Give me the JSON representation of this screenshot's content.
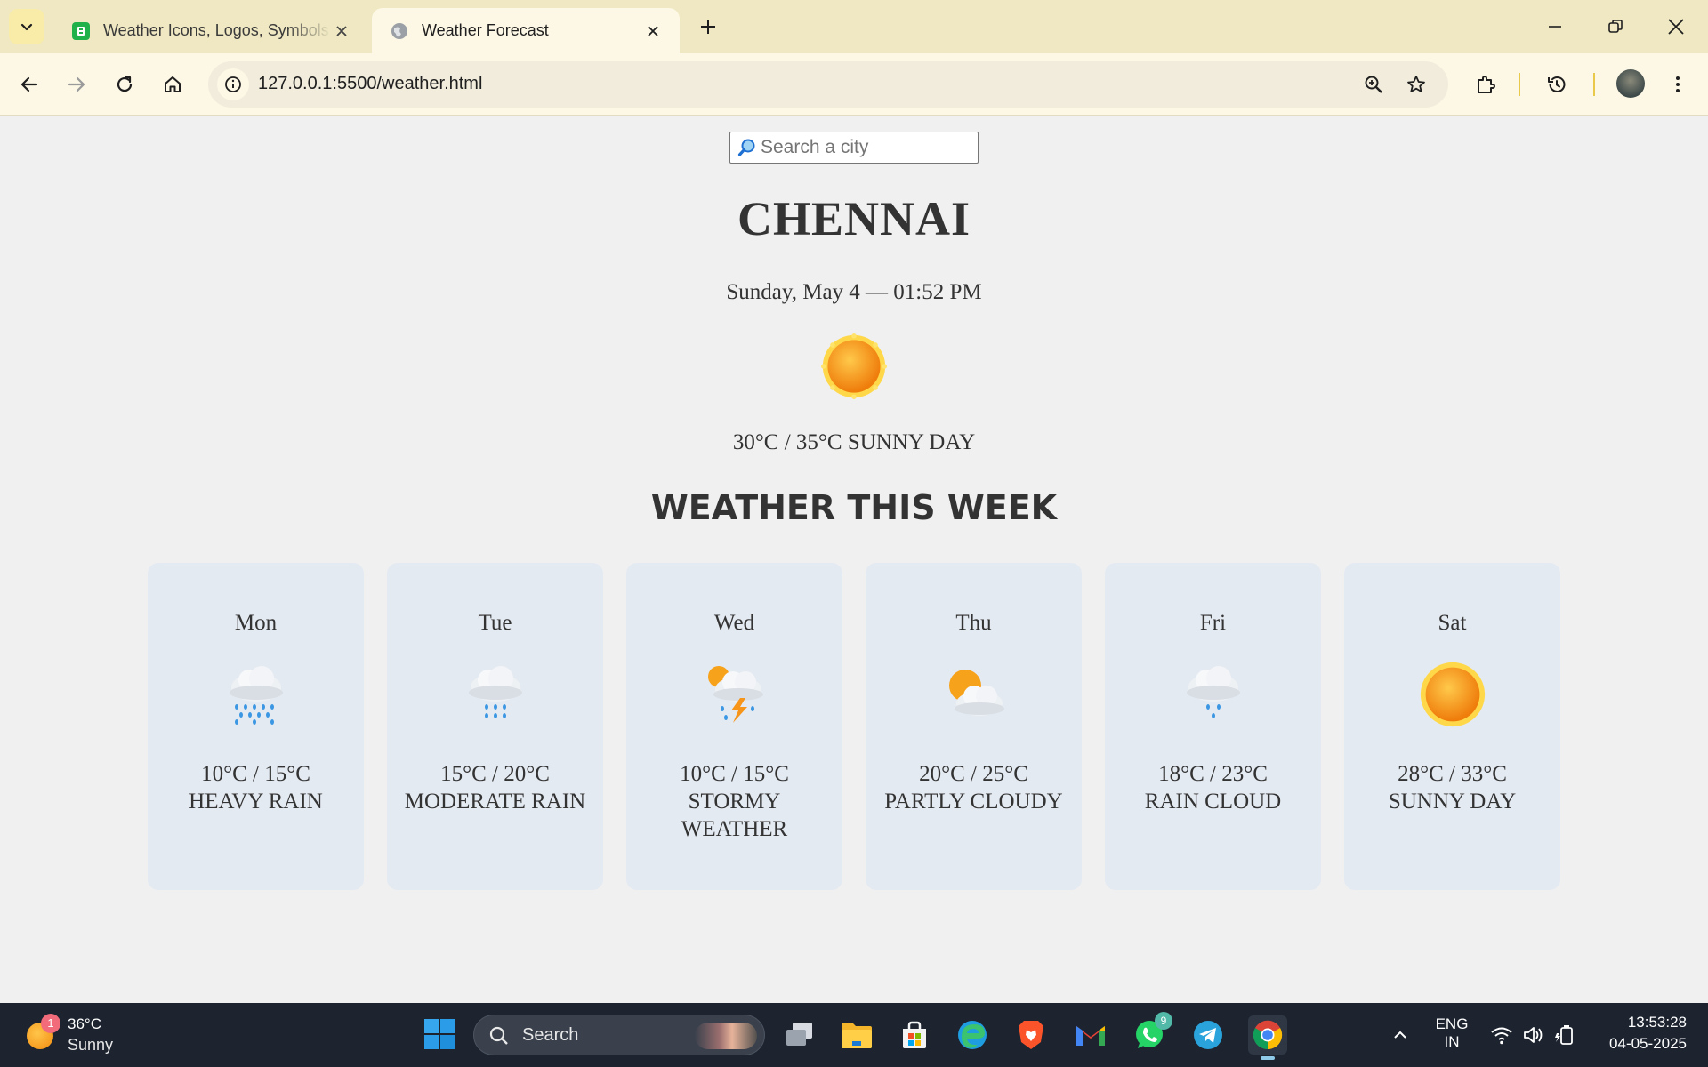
{
  "browser": {
    "tabs": [
      {
        "title": "Weather Icons, Logos, Symbols",
        "active": false
      },
      {
        "title": "Weather Forecast",
        "active": true
      }
    ],
    "url": "127.0.0.1:5500/weather.html",
    "accent": "#efe8c2"
  },
  "search": {
    "placeholder": "Search a city"
  },
  "current": {
    "city": "CHENNAI",
    "datetime": "Sunday, May 4 — 01:52 PM",
    "icon": "sun-icon",
    "summary": "30°C / 35°C SUNNY DAY"
  },
  "week": {
    "heading": "WEATHER THIS WEEK",
    "days": [
      {
        "day": "Mon",
        "temp": "10°C / 15°C",
        "desc": "HEAVY RAIN",
        "icon": "heavy-rain-icon"
      },
      {
        "day": "Tue",
        "temp": "15°C / 20°C",
        "desc": "MODERATE RAIN",
        "icon": "moderate-rain-icon"
      },
      {
        "day": "Wed",
        "temp": "10°C / 15°C",
        "desc": "STORMY WEATHER",
        "icon": "storm-icon"
      },
      {
        "day": "Thu",
        "temp": "20°C / 25°C",
        "desc": "PARTLY CLOUDY",
        "icon": "partly-cloudy-icon"
      },
      {
        "day": "Fri",
        "temp": "18°C / 23°C",
        "desc": "RAIN CLOUD",
        "icon": "rain-cloud-icon"
      },
      {
        "day": "Sat",
        "temp": "28°C / 33°C",
        "desc": "SUNNY DAY",
        "icon": "sun-icon"
      }
    ]
  },
  "taskbar": {
    "weather_temp": "36°C",
    "weather_desc": "Sunny",
    "weather_badge": "1",
    "search_label": "Search",
    "whatsapp_badge": "9",
    "lang_1": "ENG",
    "lang_2": "IN",
    "time": "13:53:28",
    "date": "04-05-2025"
  }
}
